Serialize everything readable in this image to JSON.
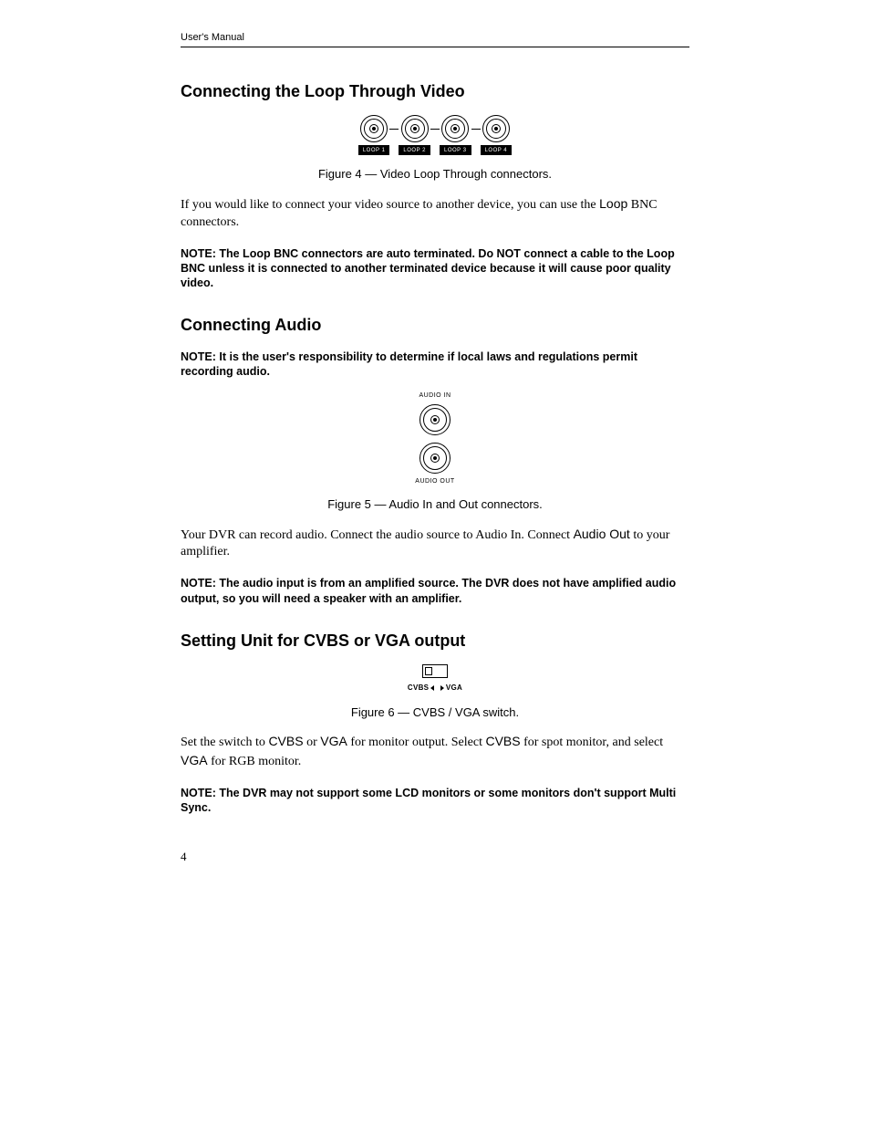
{
  "header": "User's Manual",
  "pageNumber": "4",
  "section1": {
    "title": "Connecting the Loop Through Video",
    "figureCaption": "Figure 4 — Video Loop Through connectors.",
    "loopLabels": [
      "LOOP 1",
      "LOOP 2",
      "LOOP 3",
      "LOOP 4"
    ],
    "bodyPre": "If you would like to connect your video source to another device, you can use the ",
    "bodyLoop": "Loop",
    "bodyPost": " BNC connectors.",
    "note": "NOTE:  The Loop BNC connectors are auto terminated.  Do NOT connect a cable to the Loop BNC unless it is connected to another terminated device because it will cause poor quality video."
  },
  "section2": {
    "title": "Connecting Audio",
    "note1": "NOTE:  It is the user's responsibility to determine if local laws and regulations permit recording audio.",
    "audioInLabel": "AUDIO IN",
    "audioOutLabel": "AUDIO OUT",
    "figureCaption": "Figure 5 — Audio In and Out connectors.",
    "bodyPre": "Your DVR can record audio.  Connect the audio source to Audio In.  Connect ",
    "bodyAudioOut": "Audio Out",
    "bodyPost": " to your amplifier.",
    "note2": "NOTE:  The audio input is from an amplified source.  The DVR does not have amplified audio output, so you will need a speaker with an amplifier."
  },
  "section3": {
    "title": "Setting Unit for CVBS or VGA output",
    "switchLeft": "CVBS",
    "switchRight": "VGA",
    "figureCaption": "Figure 6 — CVBS / VGA switch.",
    "body1a": "Set the switch to ",
    "body1b": "CVBS",
    "body1c": " or ",
    "body1d": "VGA",
    "body1e": " for monitor output.  Select ",
    "body1f": "CVBS",
    "body1g": " for spot monitor, and select ",
    "body1h": "VGA",
    "body1i": " for RGB monitor.",
    "note": "NOTE:  The DVR may not support some LCD monitors or some monitors don't support Multi Sync."
  }
}
